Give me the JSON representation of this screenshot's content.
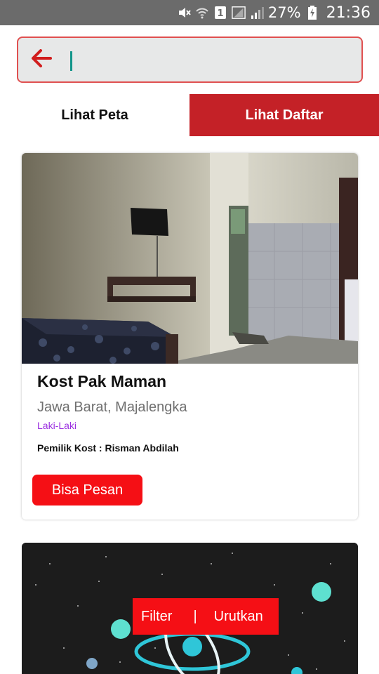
{
  "status_bar": {
    "battery": "27%",
    "time": "21:36",
    "sim_badge": "1",
    "icons": [
      "mute-icon",
      "wifi-icon",
      "sim-icon",
      "signal-icon",
      "signal-icon",
      "battery-charging-icon"
    ]
  },
  "search": {
    "back_icon": "arrow-left-icon",
    "value": "",
    "placeholder": ""
  },
  "tabs": [
    {
      "label": "Lihat Peta",
      "active": false
    },
    {
      "label": "Lihat Daftar",
      "active": true
    }
  ],
  "listings": [
    {
      "title": "Kost Pak Maman",
      "location": "Jawa Barat, Majalengka",
      "gender": "Laki-Laki",
      "owner": "Pemilik Kost : Risman Abdilah",
      "action": "Bisa Pesan"
    }
  ],
  "float_bar": {
    "filter_label": "Filter",
    "separator": "|",
    "sort_label": "Urutkan"
  },
  "colors": {
    "accent_red": "#c42127",
    "button_red": "#f50f15",
    "gender_purple": "#9b30e0",
    "caret_teal": "#13968a"
  }
}
